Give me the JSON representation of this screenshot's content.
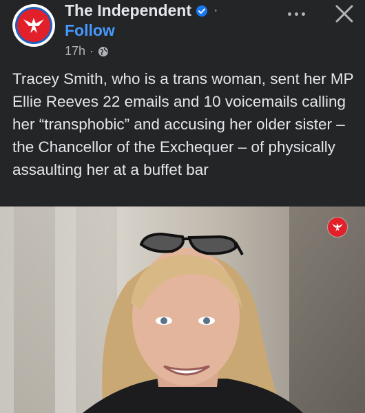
{
  "post": {
    "page_name": "The Independent",
    "follow_label": "Follow",
    "time": "17h",
    "meta_separator": "·",
    "caption": "Tracey Smith, who is a trans woman, sent her MP Ellie Reeves 22 emails and 10 voicemails calling her “transphobic” and accusing her older sister – the Chancellor of the Exchequer – of physically assaulting her at a buffet bar"
  },
  "icons": {
    "avatar": "independent-eagle-logo",
    "verified": "verified-badge-icon",
    "audience": "globe-icon",
    "more": "more-options-icon",
    "close": "close-icon",
    "photo_watermark": "independent-eagle-logo"
  },
  "colors": {
    "background": "#242526",
    "text": "#e4e6eb",
    "secondary_text": "#b0b3b8",
    "follow": "#4599ff",
    "brand_red": "#e2202a",
    "verified": "#1877f2"
  }
}
